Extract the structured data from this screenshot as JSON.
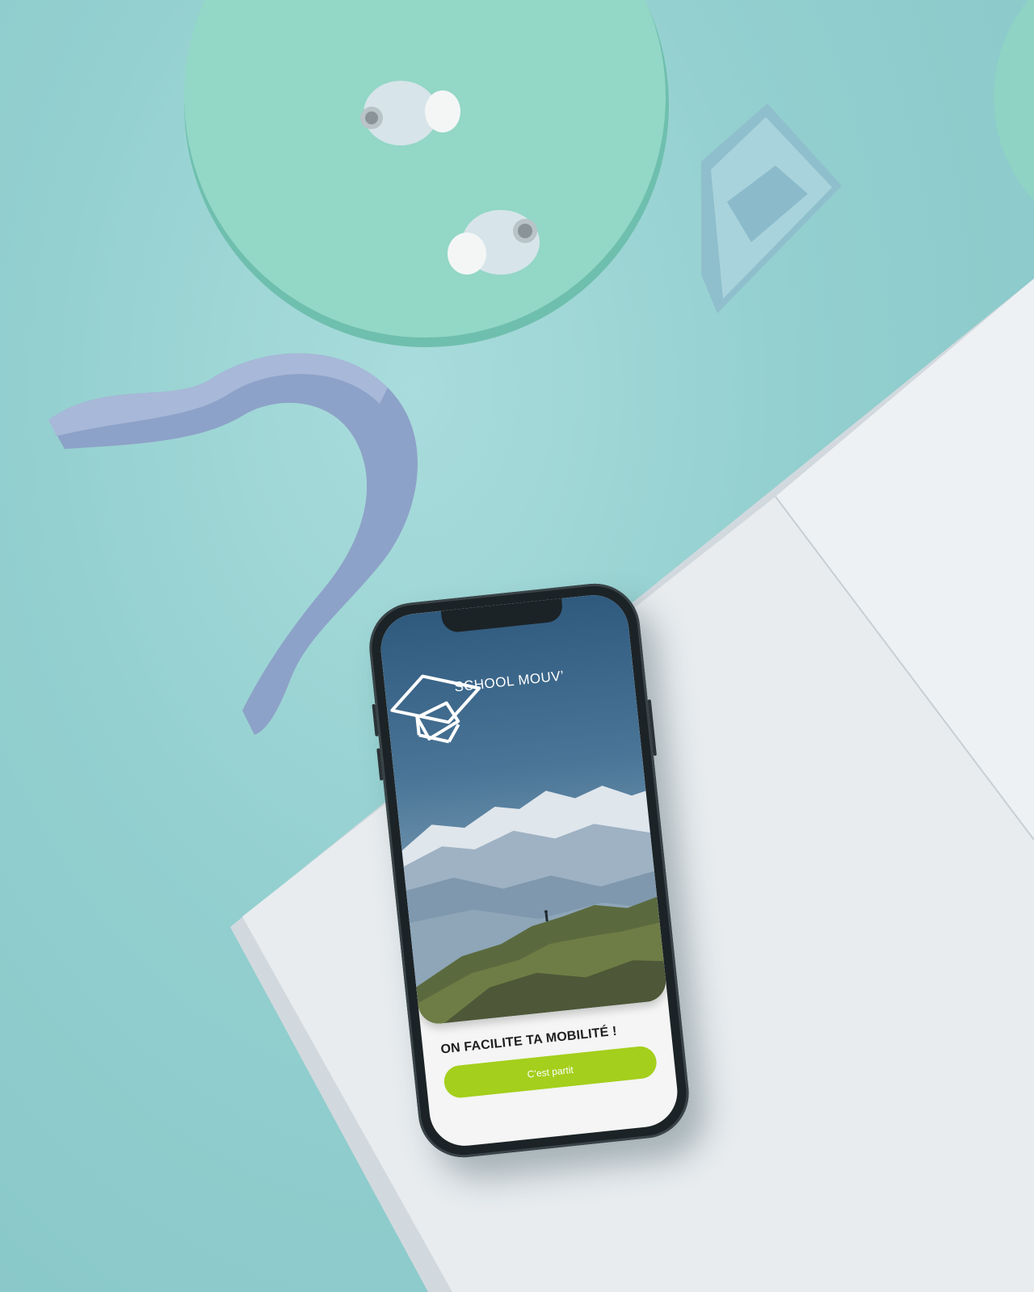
{
  "scene": {
    "background_color": "#93cfcf",
    "objects": [
      "mint-pedestal",
      "wireless-earbuds",
      "crystal-stone",
      "arch-sculpture",
      "open-notebook"
    ]
  },
  "app": {
    "brand": {
      "name": "SCHOOL MOUV’",
      "logo_icon": "open-box-icon"
    },
    "hero_image": "mountain-summit-landscape",
    "tagline": "ON FACILITE TA MOBILITÉ !",
    "cta_button": {
      "label": "C’est partit",
      "color": "#a4cf1c"
    }
  }
}
